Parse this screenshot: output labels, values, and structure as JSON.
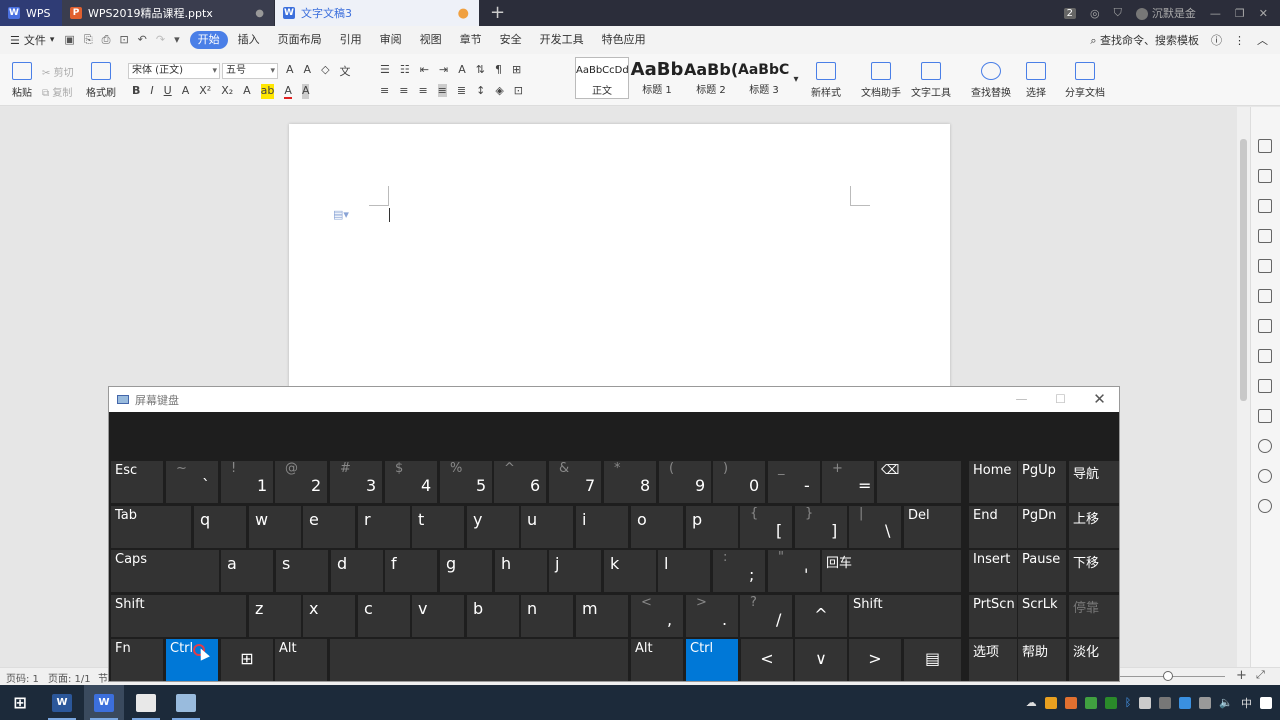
{
  "tabs": {
    "wps_label": "WPS",
    "ppt_label": "WPS2019精品课程.pptx",
    "doc_label": "文字文稿3",
    "badge": "2",
    "user": "沉默是金"
  },
  "menubar": {
    "file": "文件",
    "items": [
      "开始",
      "插入",
      "页面布局",
      "引用",
      "审阅",
      "视图",
      "章节",
      "安全",
      "开发工具",
      "特色应用"
    ],
    "search": "查找命令、搜索模板"
  },
  "ribbon": {
    "paste": "粘贴",
    "cut": "剪切",
    "copy": "复制",
    "format_painter": "格式刷",
    "font_name": "宋体 (正文)",
    "font_size": "五号",
    "styles": [
      {
        "sample": "AaBbCcDd",
        "caption": "正文"
      },
      {
        "sample": "AaBb",
        "caption": "标题 1"
      },
      {
        "sample": "AaBb(",
        "caption": "标题 2"
      },
      {
        "sample": "AaBbC(",
        "caption": "标题 3"
      }
    ],
    "new_style": "新样式",
    "doc_helper": "文档助手",
    "text_tools": "文字工具",
    "find_replace": "查找替换",
    "select": "选择",
    "share": "分享文档"
  },
  "statusbar": {
    "page_code": "页码: 1",
    "pages": "页面: 1/1",
    "section": "节"
  },
  "osk": {
    "title": "屏幕键盘",
    "rows": [
      [
        {
          "top": "Esc"
        },
        {
          "shift": "~",
          "main": "`"
        },
        {
          "shift": "!",
          "main": "1"
        },
        {
          "shift": "@",
          "main": "2"
        },
        {
          "shift": "#",
          "main": "3"
        },
        {
          "shift": "$",
          "main": "4"
        },
        {
          "shift": "%",
          "main": "5"
        },
        {
          "shift": "^",
          "main": "6"
        },
        {
          "shift": "&",
          "main": "7"
        },
        {
          "shift": "*",
          "main": "8"
        },
        {
          "shift": "(",
          "main": "9"
        },
        {
          "shift": ")",
          "main": "0"
        },
        {
          "shift": "_",
          "main": "-"
        },
        {
          "shift": "+",
          "main": "="
        },
        {
          "top": "⌫"
        }
      ],
      [
        {
          "top": "Tab"
        },
        {
          "letter": "q"
        },
        {
          "letter": "w"
        },
        {
          "letter": "e"
        },
        {
          "letter": "r"
        },
        {
          "letter": "t"
        },
        {
          "letter": "y"
        },
        {
          "letter": "u"
        },
        {
          "letter": "i"
        },
        {
          "letter": "o"
        },
        {
          "letter": "p"
        },
        {
          "shift": "{",
          "main": "["
        },
        {
          "shift": "}",
          "main": "]"
        },
        {
          "shift": "|",
          "main": "\\"
        },
        {
          "top": "Del"
        }
      ],
      [
        {
          "top": "Caps"
        },
        {
          "letter": "a"
        },
        {
          "letter": "s"
        },
        {
          "letter": "d"
        },
        {
          "letter": "f"
        },
        {
          "letter": "g"
        },
        {
          "letter": "h"
        },
        {
          "letter": "j"
        },
        {
          "letter": "k"
        },
        {
          "letter": "l"
        },
        {
          "shift": ":",
          "main": ";"
        },
        {
          "shift": "\"",
          "main": "'"
        },
        {
          "top": "回车"
        }
      ],
      [
        {
          "top": "Shift"
        },
        {
          "letter": "z"
        },
        {
          "letter": "x"
        },
        {
          "letter": "c"
        },
        {
          "letter": "v"
        },
        {
          "letter": "b"
        },
        {
          "letter": "n"
        },
        {
          "letter": "m"
        },
        {
          "shift": "<",
          "main": ","
        },
        {
          "shift": ">",
          "main": "."
        },
        {
          "shift": "?",
          "main": "/"
        },
        {
          "center": "^"
        },
        {
          "top": "Shift"
        }
      ],
      [
        {
          "top": "Fn"
        },
        {
          "top": "Ctrl",
          "blue": true
        },
        {
          "center": "⊞"
        },
        {
          "top": "Alt"
        },
        {
          "top": ""
        },
        {
          "top": "Alt"
        },
        {
          "top": "Ctrl",
          "blue": true
        },
        {
          "center": "<"
        },
        {
          "center": "∨"
        },
        {
          "center": ">"
        },
        {
          "center": "▤"
        }
      ]
    ],
    "nav_keys": [
      [
        "Home",
        "PgUp",
        "导航"
      ],
      [
        "End",
        "PgDn",
        "上移"
      ],
      [
        "Insert",
        "Pause",
        "下移"
      ],
      [
        "PrtScn",
        "ScrLk",
        "停靠"
      ],
      [
        "选项",
        "帮助",
        "淡化"
      ]
    ]
  },
  "taskbar": {
    "ime": "中"
  }
}
